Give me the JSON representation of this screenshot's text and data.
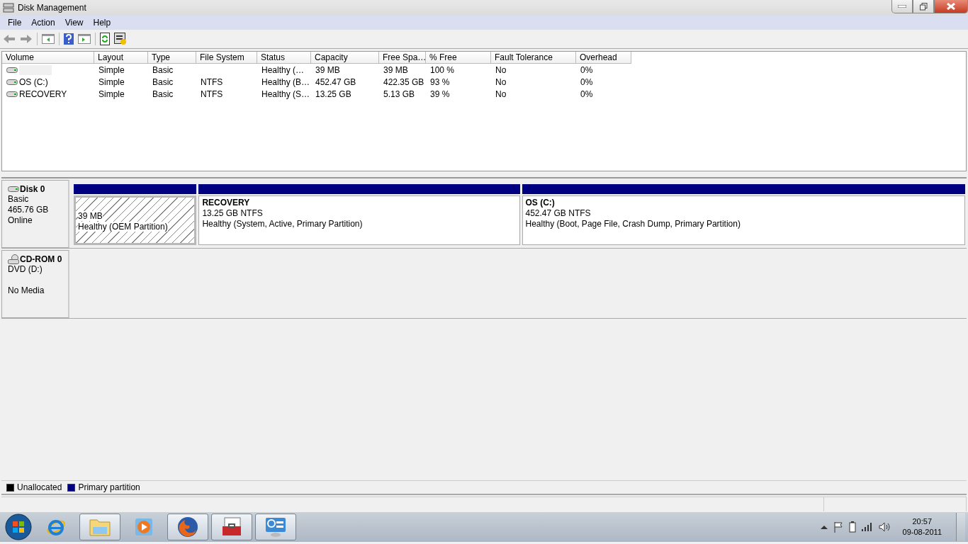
{
  "window": {
    "title": "Disk Management"
  },
  "menu": [
    "File",
    "Action",
    "View",
    "Help"
  ],
  "volume_table": {
    "columns": [
      "Volume",
      "Layout",
      "Type",
      "File System",
      "Status",
      "Capacity",
      "Free Spa…",
      "% Free",
      "Fault Tolerance",
      "Overhead"
    ],
    "rows": [
      {
        "cells": [
          "",
          "Simple",
          "Basic",
          "",
          "Healthy (…",
          "39 MB",
          "39 MB",
          "100 %",
          "No",
          "0%"
        ]
      },
      {
        "cells": [
          "OS (C:)",
          "Simple",
          "Basic",
          "NTFS",
          "Healthy (B…",
          "452.47 GB",
          "422.35 GB",
          "93 %",
          "No",
          "0%"
        ]
      },
      {
        "cells": [
          "RECOVERY",
          "Simple",
          "Basic",
          "NTFS",
          "Healthy (S…",
          "13.25 GB",
          "5.13 GB",
          "39 %",
          "No",
          "0%"
        ]
      }
    ]
  },
  "disks": [
    {
      "kind": "disk",
      "name": "Disk 0",
      "lines": [
        "Basic",
        "465.76 GB",
        "Online"
      ],
      "partitions": [
        {
          "size": "39 MB",
          "status": "Healthy (OEM Partition)",
          "selected": true
        },
        {
          "name": "RECOVERY",
          "size": "13.25 GB NTFS",
          "status": "Healthy (System, Active, Primary Partition)",
          "selected": false
        },
        {
          "name": "OS  (C:)",
          "size": "452.47 GB NTFS",
          "status": "Healthy (Boot, Page File, Crash Dump, Primary Partition)",
          "selected": false
        }
      ]
    },
    {
      "kind": "cdrom",
      "name": "CD-ROM 0",
      "lines": [
        "DVD (D:)",
        "No Media"
      ]
    }
  ],
  "legend": [
    {
      "label": "Unallocated",
      "color": "#000000"
    },
    {
      "label": "Primary partition",
      "color": "#000080"
    }
  ],
  "taskbar": {
    "apps": [
      {
        "kind": "ie",
        "running": false
      },
      {
        "kind": "folder",
        "running": true
      },
      {
        "kind": "media",
        "running": false
      },
      {
        "kind": "firefox",
        "running": true
      },
      {
        "kind": "toolbox",
        "running": true
      },
      {
        "kind": "panel",
        "running": true
      }
    ],
    "time": "20:57",
    "date": "09-08-2011"
  }
}
